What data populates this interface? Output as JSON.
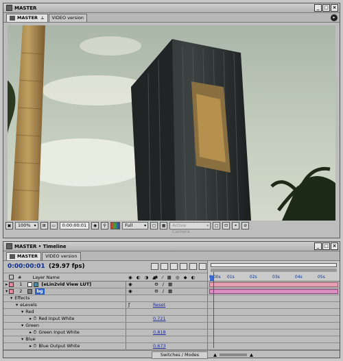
{
  "comp_window": {
    "title": "MASTER",
    "tabs": [
      {
        "label": "MASTER"
      },
      {
        "label": "VIDEO version"
      }
    ],
    "zoom": "100%",
    "timecode": "0:00:00:01",
    "resolution": "Full",
    "camera": "Active Camera"
  },
  "timeline_window": {
    "title": "MASTER • Timeline",
    "tabs": [
      {
        "label": "MASTER"
      },
      {
        "label": "VIDEO version"
      }
    ],
    "current_time": "0:00:00:01",
    "fps": "(29.97 fps)",
    "column_hash": "#",
    "column_layer_name": "Layer Name",
    "ruler_ticks": [
      "0:00s",
      "01s",
      "02s",
      "03s",
      "04s",
      "05s"
    ],
    "layers": [
      {
        "num": "1",
        "name": "[eLin2vid View LUT]",
        "color": "#e88aa0"
      },
      {
        "num": "2",
        "name": "bg",
        "color": "#e88aa0"
      }
    ],
    "effects_label": "Effects",
    "effect_name": "eLevels",
    "reset_label": "Reset",
    "red_label": "Red",
    "red_input_white_label": "Red Input White",
    "red_input_white_value": "0.721",
    "green_label": "Green",
    "green_input_white_label": "Green Input White",
    "green_input_white_value": "0.818",
    "blue_label": "Blue",
    "blue_output_white_label": "Blue Output White",
    "blue_output_white_value": "0.673",
    "switches_modes": "Switches / Modes"
  }
}
